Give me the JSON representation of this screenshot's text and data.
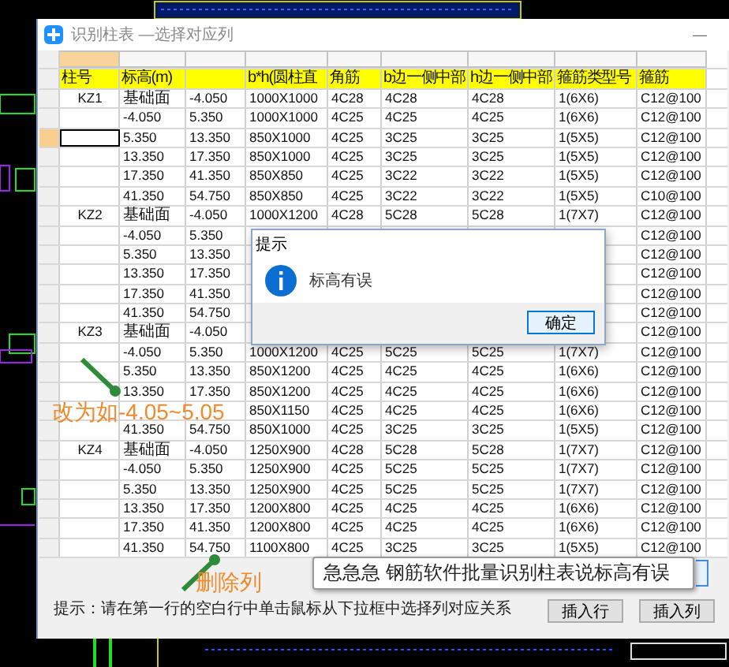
{
  "window": {
    "title": "识别柱表 —选择对应列",
    "minimize": "—"
  },
  "table": {
    "columns": [
      {
        "label": "柱号"
      },
      {
        "label": "标高(m)"
      },
      {},
      {
        "label": "b*h(圆柱直"
      },
      {
        "label": "角筋"
      },
      {
        "label": "b边一侧中部"
      },
      {
        "label": "h边一侧中部"
      },
      {
        "label": "箍筋类型号"
      },
      {
        "label": "箍筋"
      }
    ],
    "picker_row": [
      {
        "selected": true
      },
      {
        "selected": false
      },
      {
        "selected": false
      },
      {
        "selected": false
      },
      {
        "selected": false
      },
      {
        "selected": false
      },
      {
        "selected": false
      },
      {
        "selected": false
      },
      {
        "selected": false
      }
    ],
    "rows": [
      {
        "selected": false,
        "cells": [
          "KZ1",
          "基础面",
          "-4.050",
          "1000X1000",
          "4C28",
          "4C28",
          "4C28",
          "1(6X6)",
          "C12@100"
        ]
      },
      {
        "selected": false,
        "cells": [
          null,
          "-4.050",
          "5.350",
          "1000X1000",
          "4C25",
          "4C25",
          "4C25",
          "1(6X6)",
          "C12@100"
        ]
      },
      {
        "selected": true,
        "cells": [
          null,
          "5.350",
          "13.350",
          "850X1000",
          "4C25",
          "3C25",
          "3C25",
          "1(5X5)",
          "C12@100"
        ]
      },
      {
        "selected": false,
        "cells": [
          null,
          "13.350",
          "17.350",
          "850X1000",
          "4C25",
          "3C25",
          "3C25",
          "1(5X5)",
          "C12@100"
        ]
      },
      {
        "selected": false,
        "cells": [
          null,
          "17.350",
          "41.350",
          "850X850",
          "4C25",
          "3C22",
          "3C22",
          "1(5X5)",
          "C12@100"
        ]
      },
      {
        "selected": false,
        "cells": [
          null,
          "41.350",
          "54.750",
          "850X850",
          "4C25",
          "3C22",
          "3C22",
          "1(5X5)",
          "C10@100"
        ]
      },
      {
        "selected": false,
        "cells": [
          "KZ2",
          "基础面",
          "-4.050",
          "1000X1200",
          "4C28",
          "5C28",
          "5C28",
          "1(7X7)",
          "C12@100"
        ]
      },
      {
        "selected": false,
        "cells": [
          null,
          "-4.050",
          "5.350",
          null,
          null,
          null,
          null,
          null,
          "C12@100"
        ]
      },
      {
        "selected": false,
        "cells": [
          null,
          "5.350",
          "13.350",
          null,
          null,
          null,
          null,
          null,
          "C12@100"
        ]
      },
      {
        "selected": false,
        "cells": [
          null,
          "13.350",
          "17.350",
          null,
          null,
          null,
          null,
          null,
          "C12@100"
        ]
      },
      {
        "selected": false,
        "cells": [
          null,
          "17.350",
          "41.350",
          null,
          null,
          null,
          null,
          null,
          "C12@100"
        ]
      },
      {
        "selected": false,
        "cells": [
          null,
          "41.350",
          "54.750",
          null,
          null,
          null,
          null,
          null,
          "C12@100"
        ]
      },
      {
        "selected": false,
        "cells": [
          "KZ3",
          "基础面",
          "-4.050",
          null,
          null,
          null,
          null,
          null,
          "C12@100"
        ]
      },
      {
        "selected": false,
        "cells": [
          null,
          "-4.050",
          "5.350",
          "1000X1200",
          "4C25",
          "5C25",
          "5C25",
          "1(7X7)",
          "C12@100"
        ]
      },
      {
        "selected": false,
        "cells": [
          null,
          "5.350",
          "13.350",
          "850X1200",
          "4C25",
          "4C25",
          "4C25",
          "1(6X6)",
          "C12@100"
        ]
      },
      {
        "selected": false,
        "cells": [
          null,
          "13.350",
          "17.350",
          "850X1200",
          "4C25",
          "4C25",
          "4C25",
          "1(6X6)",
          "C12@100"
        ]
      },
      {
        "selected": false,
        "cells": [
          null,
          null,
          null,
          "850X1150",
          "4C25",
          "4C25",
          "4C25",
          "1(6X6)",
          "C12@100"
        ]
      },
      {
        "selected": false,
        "cells": [
          null,
          "41.350",
          "54.750",
          "850X1000",
          "4C25",
          "3C25",
          "3C25",
          "1(5X5)",
          "C12@100"
        ]
      },
      {
        "selected": false,
        "cells": [
          "KZ4",
          "基础面",
          "-4.050",
          "1250X900",
          "4C28",
          "5C28",
          "5C28",
          "1(7X7)",
          "C12@100"
        ]
      },
      {
        "selected": false,
        "cells": [
          null,
          "-4.050",
          "5.350",
          "1250X900",
          "4C25",
          "5C25",
          "5C25",
          "1(7X7)",
          "C12@100"
        ]
      },
      {
        "selected": false,
        "cells": [
          null,
          "5.350",
          "13.350",
          "1250X900",
          "4C25",
          "5C25",
          "5C25",
          "1(7X7)",
          "C12@100"
        ]
      },
      {
        "selected": false,
        "cells": [
          null,
          "13.350",
          "17.350",
          "1200X800",
          "4C25",
          "4C25",
          "4C25",
          "1(6X6)",
          "C12@100"
        ]
      },
      {
        "selected": false,
        "cells": [
          null,
          "17.350",
          "41.350",
          "1200X800",
          "4C25",
          "4C25",
          "4C25",
          "1(6X6)",
          "C12@100"
        ]
      },
      {
        "selected": false,
        "cells": [
          null,
          "41.350",
          "54.750",
          "1100X800",
          "4C25",
          "3C25",
          "3C25",
          "1(5X5)",
          "C12@100"
        ]
      }
    ]
  },
  "dialog": {
    "title": "提示",
    "message": "标高有误",
    "button": "确定"
  },
  "hint": "提示：请在第一行的空白行中单击鼠标从下拉框中选择列对应关系",
  "buttons": [
    "插入行",
    "插入列"
  ],
  "annotations": [
    {
      "kind": "arrow-note",
      "text": "改为如-4.05~5.05"
    },
    {
      "kind": "arrow-note",
      "text": "删除列"
    }
  ],
  "caption": "急急急  钢筋软件批量识别柱表说标高有误"
}
